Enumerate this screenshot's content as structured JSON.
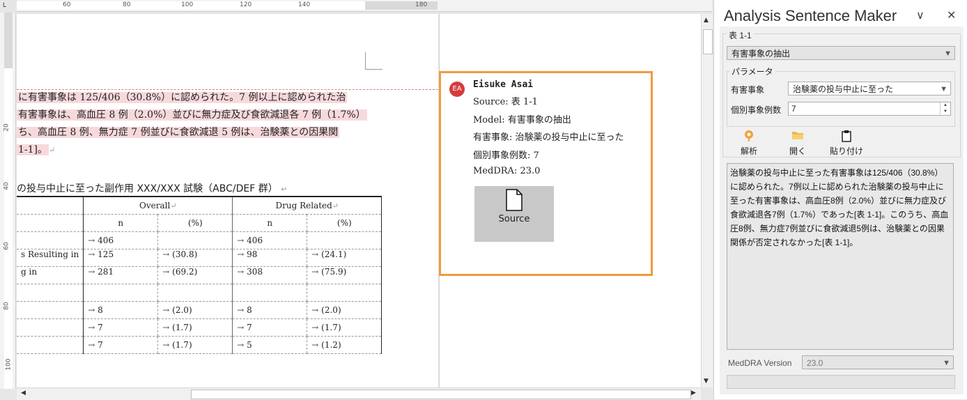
{
  "ruler": {
    "top_ticks": [
      "60",
      "80",
      "100",
      "120",
      "140",
      "180"
    ],
    "left_ticks": [
      "20",
      "40",
      "60",
      "80",
      "100"
    ],
    "corner": "L"
  },
  "document": {
    "para_lines": [
      "に有害事象は 125/406（30.8%）に認められた。7 例以上に認められた治",
      "有害事象は、高血圧 8 例（2.0%）並びに無力症及び食欲減退各 7 例（1.7%）",
      "ち、高血圧 8 例、無力症 7 例並びに食欲減退 5 例は、治験薬との因果関",
      " 1-1]。"
    ],
    "table_title": "の投与中止に至った副作用 XXX/XXX 試験（ABC/DEF 群）",
    "table": {
      "group_headers": [
        "Overall",
        "Drug Related"
      ],
      "sub_headers": [
        "n",
        "(%)",
        "n",
        "(%)"
      ],
      "rows": [
        {
          "stub": "",
          "cells": [
            "406",
            "",
            "406",
            ""
          ]
        },
        {
          "stub": "s Resulting in",
          "cells": [
            "125",
            "(30.8)",
            "98",
            "(24.1)"
          ]
        },
        {
          "stub": "g in",
          "cells": [
            "281",
            "(69.2)",
            "308",
            "(75.9)"
          ]
        },
        {
          "stub": "",
          "cells": [
            "",
            "",
            "",
            ""
          ]
        },
        {
          "stub": "",
          "cells": [
            "8",
            "(2.0)",
            "8",
            "(2.0)"
          ]
        },
        {
          "stub": "",
          "cells": [
            "7",
            "(1.7)",
            "7",
            "(1.7)"
          ]
        },
        {
          "stub": "",
          "cells": [
            "7",
            "(1.7)",
            "5",
            "(1.2)"
          ]
        }
      ]
    }
  },
  "comment": {
    "avatar": "EA",
    "author": "Eisuke Asai",
    "lines": [
      "Source: 表 1-1",
      "Model: 有害事象の抽出",
      "有害事象: 治験薬の投与中止に至った",
      "個別事象例数: 7",
      "MedDRA: 23.0"
    ],
    "source_button": "Source"
  },
  "panel": {
    "title": "Analysis Sentence Maker",
    "collapse_glyph": "∨",
    "close_glyph": "✕",
    "table_group_label": "表 1-1",
    "model_select": "有害事象の抽出",
    "params_group_label": "パラメータ",
    "param_ae_label": "有害事象",
    "param_ae_value": "治験薬の投与中止に至った",
    "param_count_label": "個別事象例数",
    "param_count_value": "7",
    "tools": [
      {
        "label": "解析",
        "icon": "analyze-icon"
      },
      {
        "label": "開く",
        "icon": "folder-open-icon"
      },
      {
        "label": "貼り付け",
        "icon": "clipboard-icon"
      }
    ],
    "result_text": "治験薬の投与中止に至った有害事象は125/406（30.8%）に認められた。7例以上に認められた治験薬の投与中止に至った有害事象は、高血圧8例（2.0%）並びに無力症及び食欲減退各7例（1.7%）であった[表 1-1]。このうち、高血圧8例、無力症7例並びに食欲減退5例は、治験薬との因果関係が否定されなかった[表 1-1]。",
    "meddra_label": "MedDRA Version",
    "meddra_value": "23.0"
  },
  "colors": {
    "accent_comment_border": "#f09a3e",
    "avatar": "#d63b3b",
    "highlight": "#f7d9dc"
  }
}
